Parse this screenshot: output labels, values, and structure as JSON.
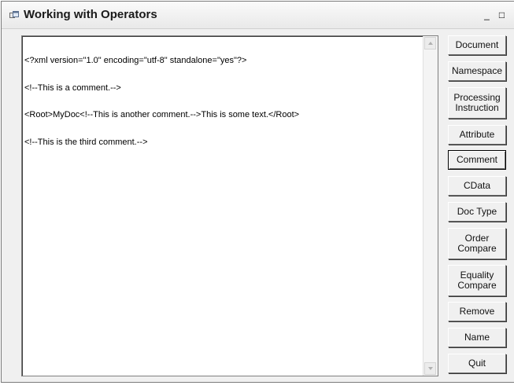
{
  "window": {
    "title": "Working with Operators",
    "controls": {
      "minimize": "_",
      "maximize": "□",
      "close": "×"
    }
  },
  "editor": {
    "lines": [
      "<?xml version=\"1.0\" encoding=\"utf-8\" standalone=\"yes\"?>",
      "<!--This is a comment.-->",
      "<Root>MyDoc<!--This is another comment.-->This is some text.</Root>",
      "<!--This is the third comment.-->"
    ]
  },
  "buttons": [
    {
      "name": "document-button",
      "label": "Document"
    },
    {
      "name": "namespace-button",
      "label": "Namespace"
    },
    {
      "name": "processing-instruction-button",
      "label": "Processing\nInstruction"
    },
    {
      "name": "attribute-button",
      "label": "Attribute"
    },
    {
      "name": "comment-button",
      "label": "Comment",
      "focused": true
    },
    {
      "name": "cdata-button",
      "label": "CData"
    },
    {
      "name": "doc-type-button",
      "label": "Doc Type"
    },
    {
      "name": "order-compare-button",
      "label": "Order\nCompare"
    },
    {
      "name": "equality-compare-button",
      "label": "Equality\nCompare"
    },
    {
      "name": "remove-button",
      "label": "Remove"
    },
    {
      "name": "name-button",
      "label": "Name"
    },
    {
      "name": "quit-button",
      "label": "Quit"
    }
  ]
}
